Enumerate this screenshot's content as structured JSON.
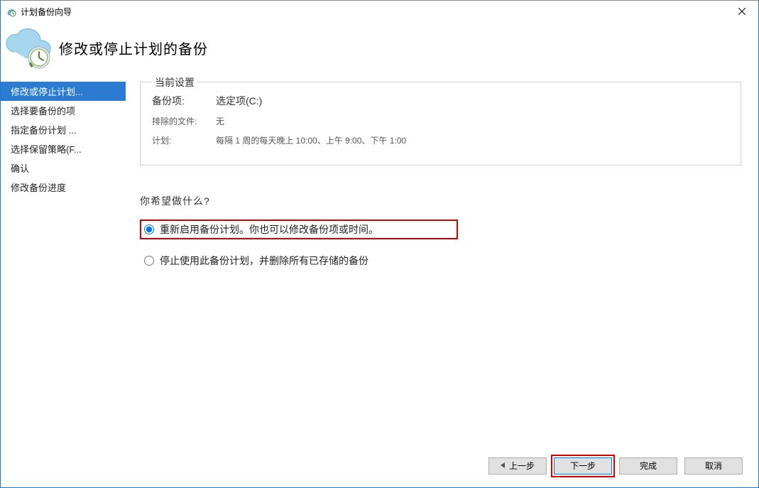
{
  "window": {
    "title": "计划备份向导"
  },
  "header": {
    "title": "修改或停止计划的备份"
  },
  "sidebar": {
    "items": [
      {
        "label": "修改或停止计划...",
        "active": true
      },
      {
        "label": "选择要备份的项",
        "active": false
      },
      {
        "label": "指定备份计划 ...",
        "active": false
      },
      {
        "label": "选择保留策略(F...",
        "active": false
      },
      {
        "label": "确认",
        "active": false
      },
      {
        "label": "修改备份进度",
        "active": false
      }
    ]
  },
  "settings": {
    "legend": "当前设置",
    "backup_items_label": "备份项:",
    "backup_items_value": "选定项(C:)",
    "exclude_label": "排除的文件:",
    "exclude_value": "无",
    "schedule_label": "计划:",
    "schedule_value": "每隔 1 周的每天晚上 10:00、上午 9:00、下午 1:00"
  },
  "question": "你希望做什么?",
  "options": {
    "reenable": "重新启用备份计划。你也可以修改备份项或时间。",
    "stop": "停止使用此备份计划，并删除所有已存储的备份"
  },
  "footer": {
    "prev": "上一步",
    "next": "下一步",
    "finish": "完成",
    "cancel": "取消"
  }
}
